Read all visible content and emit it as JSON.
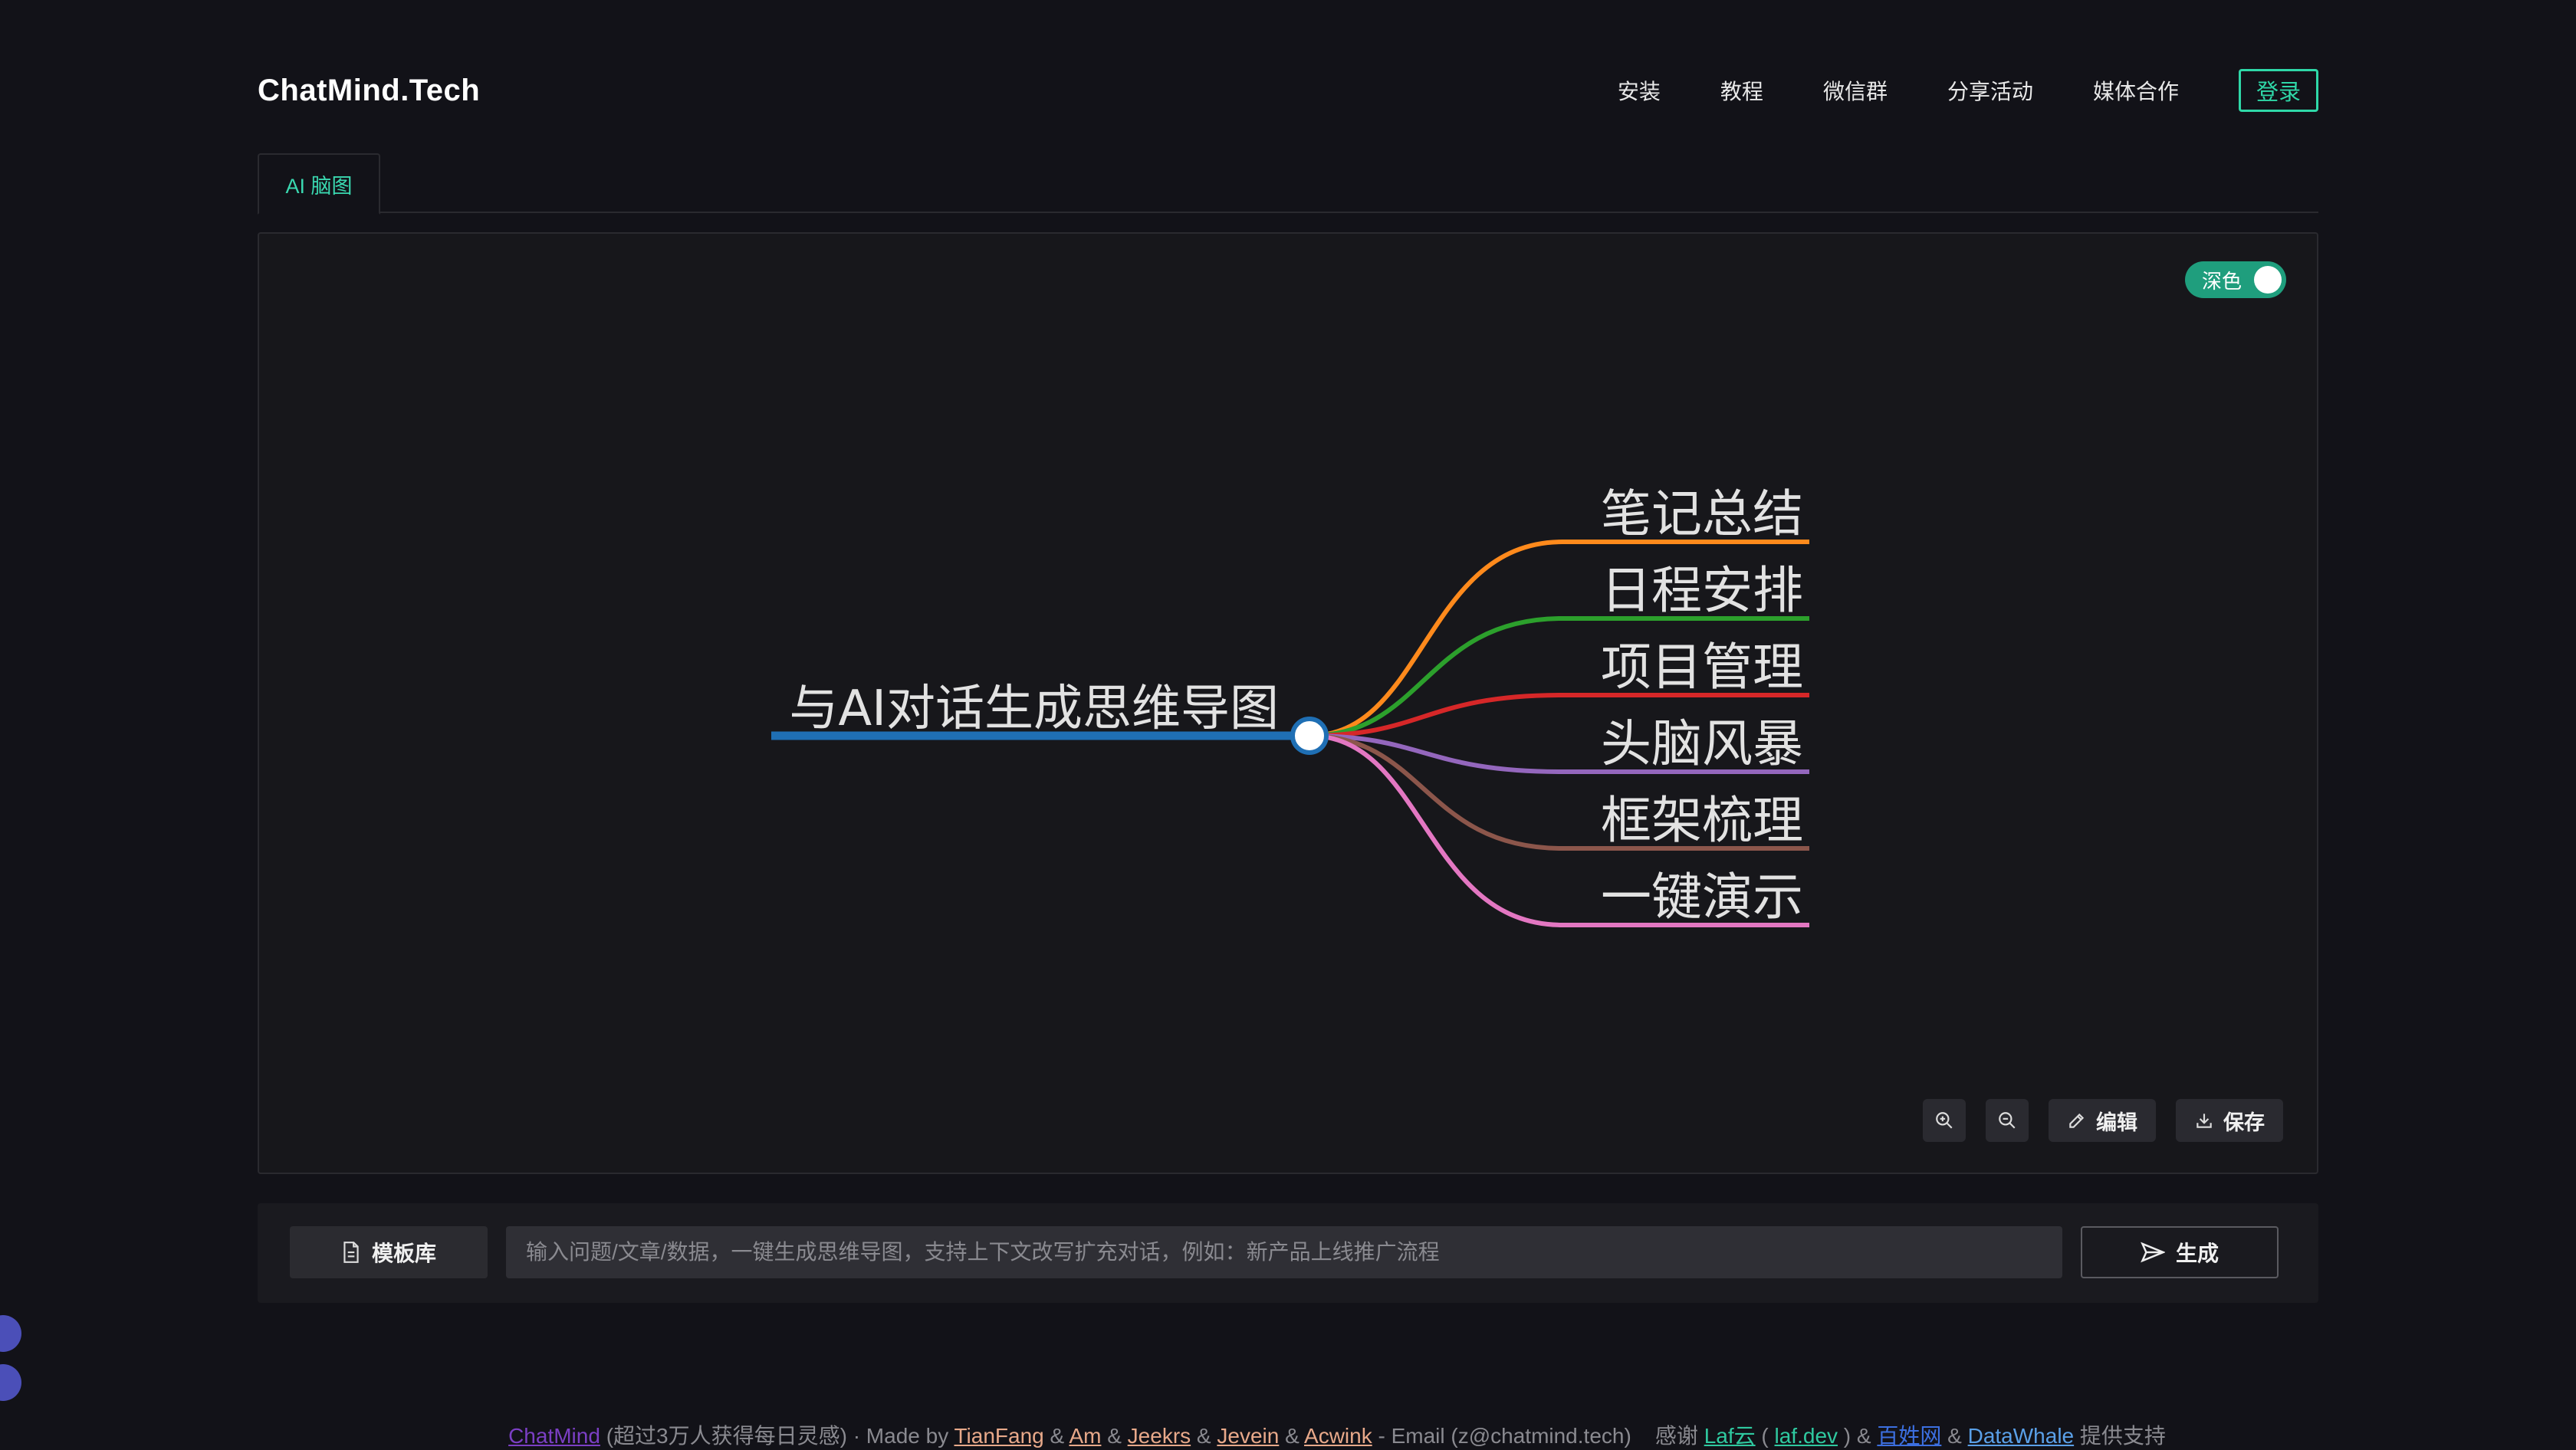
{
  "brand": "ChatMind.Tech",
  "nav": [
    "安装",
    "教程",
    "微信群",
    "分享活动",
    "媒体合作"
  ],
  "login_label": "登录",
  "tab_label": "AI 脑图",
  "theme_toggle_label": "深色",
  "mindmap": {
    "root": "与AI对话生成思维导图",
    "root_color": "#1f6fb4",
    "branches": [
      {
        "label": "笔记总结",
        "color": "#ff8a1c"
      },
      {
        "label": "日程安排",
        "color": "#2ca02c"
      },
      {
        "label": "项目管理",
        "color": "#d62728"
      },
      {
        "label": "头脑风暴",
        "color": "#9467bd"
      },
      {
        "label": "框架梳理",
        "color": "#8c564b"
      },
      {
        "label": "一键演示",
        "color": "#e377c2"
      }
    ]
  },
  "controls": {
    "edit_label": "编辑",
    "save_label": "保存"
  },
  "composer": {
    "template_label": "模板库",
    "input_placeholder": "输入问题/文章/数据，一键生成思维导图，支持上下文改写扩充对话，例如：新产品上线推广流程",
    "generate_label": "生成"
  },
  "footer": {
    "chatmind": "ChatMind",
    "tagline": " (超过3万人获得每日灵感) · Made by ",
    "authors": [
      "TianFang",
      "Am",
      "Jeekrs",
      "Jevein",
      "Acwink"
    ],
    "email": " - Email (z@chatmind.tech)    感谢 ",
    "laf": "Laf云",
    "laf_dev": "laf.dev",
    "baixing": "百姓网",
    "datawhale": "DataWhale",
    "support": " 提供支持",
    "colors": {
      "chatmind": "#7b3fc4",
      "authors": "#e8a98a",
      "laf": "#2fc9a0",
      "baixing": "#3c6fe0",
      "datawhale": "#5aa0e8"
    }
  }
}
